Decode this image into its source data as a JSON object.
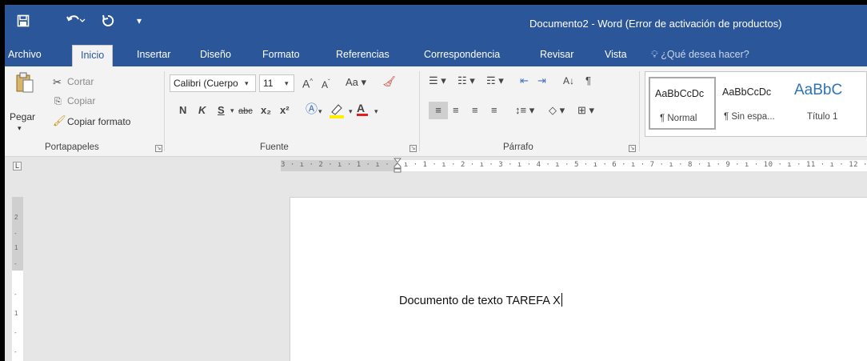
{
  "title_bar": {
    "doc_title": "Documento2 - Word (Error de activación de productos)",
    "save_icon": "save-icon",
    "undo_icon": "undo-icon",
    "redo_icon": "redo-icon",
    "customize_icon": "customize-qat-icon",
    "brand_color": "#2b579a"
  },
  "tabs": {
    "file": "Archivo",
    "home": "Inicio",
    "insert": "Insertar",
    "design": "Diseño",
    "format": "Formato",
    "references": "Referencias",
    "mailings": "Correspondencia",
    "review": "Revisar",
    "view": "Vista",
    "tell_me": "¿Qué desea hacer?"
  },
  "clipboard": {
    "paste": "Pegar",
    "cut": "Cortar",
    "copy": "Copiar",
    "format_painter": "Copiar formato",
    "label": "Portapapeles"
  },
  "font": {
    "font_name": "Calibri (Cuerpo",
    "font_size": "11",
    "case_button": "Aa",
    "bold": "N",
    "italic": "K",
    "underline": "S",
    "strike": "abc",
    "subscript": "x₂",
    "superscript": "x²",
    "label": "Fuente"
  },
  "paragraph": {
    "label": "Párrafo"
  },
  "styles": {
    "items": [
      {
        "sample": "AaBbCcDc",
        "name": "¶ Normal"
      },
      {
        "sample": "AaBbCcDc",
        "name": "¶ Sin espa..."
      },
      {
        "sample": "AaBbC",
        "name": "Título 1"
      }
    ]
  },
  "ruler": {
    "ticks": "3 · ı · 2 · ı · 1 · ı ·    · ı · 1 · ı · 2 · ı · 3 · ı · 4 · ı · 5 · ı · 6 · ı · 7 · ı · 8 · ı · 9 · ı · 10 · ı · 11 · ı · 12 · ı",
    "tab_selector": "L"
  },
  "document": {
    "text": "Documento de texto TAREFA X"
  }
}
